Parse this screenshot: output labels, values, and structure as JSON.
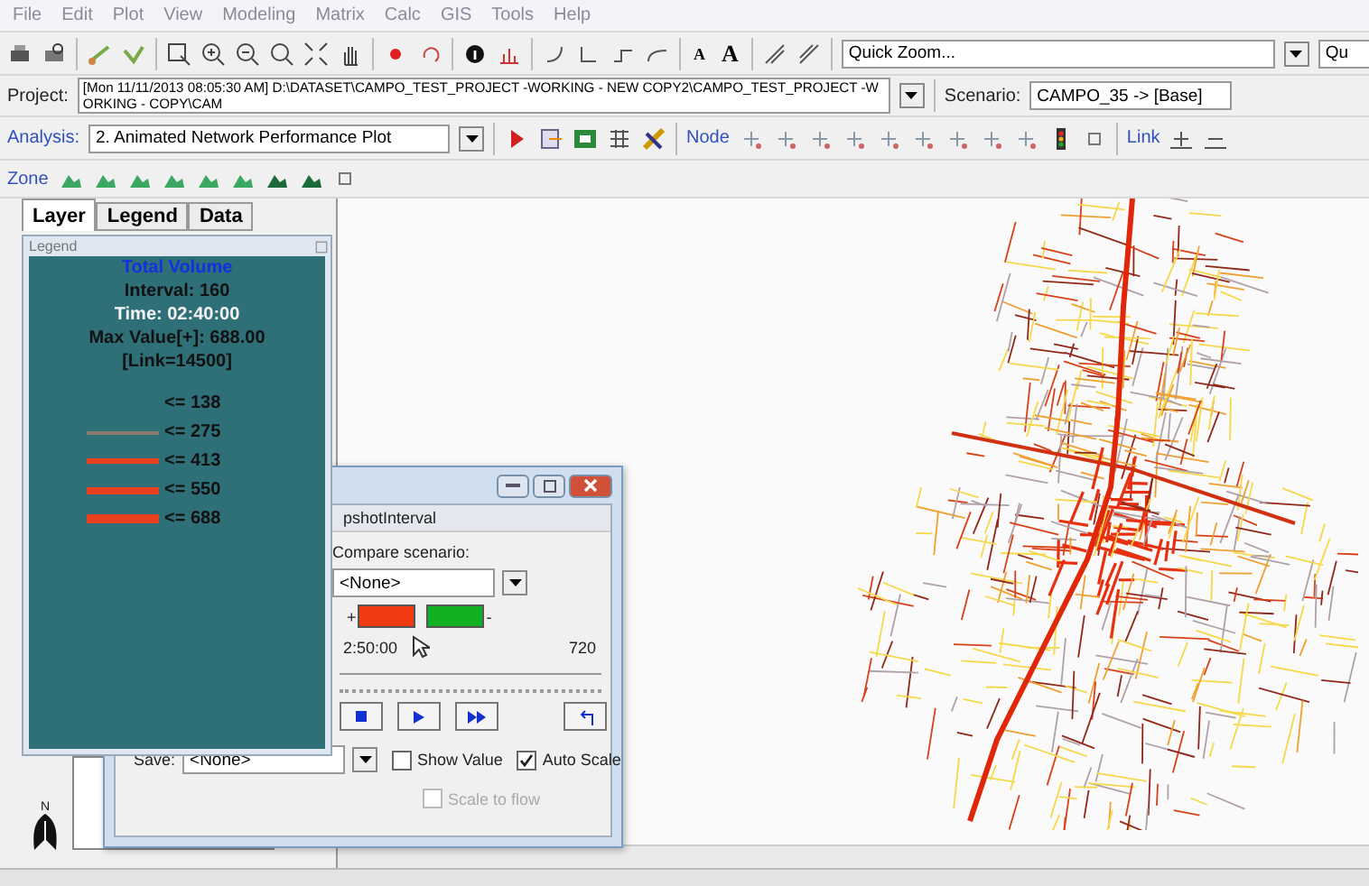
{
  "menu": [
    "File",
    "Edit",
    "Plot",
    "View",
    "Modeling",
    "Matrix",
    "Calc",
    "GIS",
    "Tools",
    "Help"
  ],
  "toolbar": {
    "font_buttons": [
      "A",
      "A"
    ],
    "quick_zoom": "Quick Zoom...",
    "cut_field": "Qu"
  },
  "project": {
    "label": "Project:",
    "value": "[Mon 11/11/2013 08:05:30 AM] D:\\DATASET\\CAMPO_TEST_PROJECT -WORKING - NEW COPY2\\CAMPO_TEST_PROJECT -WORKING - COPY\\CAM"
  },
  "scenario": {
    "label": "Scenario:",
    "value": "CAMPO_35 -> [Base]"
  },
  "analysis": {
    "label": "Analysis:",
    "value": "2. Animated Network Performance Plot",
    "node_label": "Node",
    "link_label": "Link"
  },
  "zone": {
    "label": "Zone"
  },
  "tabs": [
    {
      "label": "Layer",
      "selected": true
    },
    {
      "label": "Legend",
      "selected": false
    },
    {
      "label": "Data",
      "selected": false
    }
  ],
  "legend": {
    "title": "Legend",
    "heading": "Total Volume",
    "interval": "Interval: 160",
    "time": "Time: 02:40:00",
    "max_value": "Max Value[+]: 688.00",
    "link": "[Link=14500]",
    "classes": [
      {
        "label": "<= 138",
        "kind": "none"
      },
      {
        "label": "<= 275",
        "kind": "thin",
        "color": "#8a7a70"
      },
      {
        "label": "<= 413",
        "kind": "medium",
        "color": "#e8401c"
      },
      {
        "label": "<= 550",
        "kind": "thick",
        "color": "#e8401c"
      },
      {
        "label": "<= 688",
        "kind": "heavy",
        "color": "#e8401c"
      }
    ]
  },
  "dialog": {
    "tab": "pshotInterval",
    "compare_label": "Compare scenario:",
    "compare_value": "<None>",
    "plus": "+",
    "minus": "-",
    "time": "2:50:00",
    "end": "720",
    "save_label": "Save:",
    "save_value": "<None>",
    "checkboxes": [
      {
        "label": "Show Value",
        "checked": false,
        "disabled": false
      },
      {
        "label": "Auto Scale",
        "checked": true,
        "disabled": false
      },
      {
        "label": "Scale to flow",
        "checked": false,
        "disabled": true
      }
    ]
  },
  "north": "N"
}
